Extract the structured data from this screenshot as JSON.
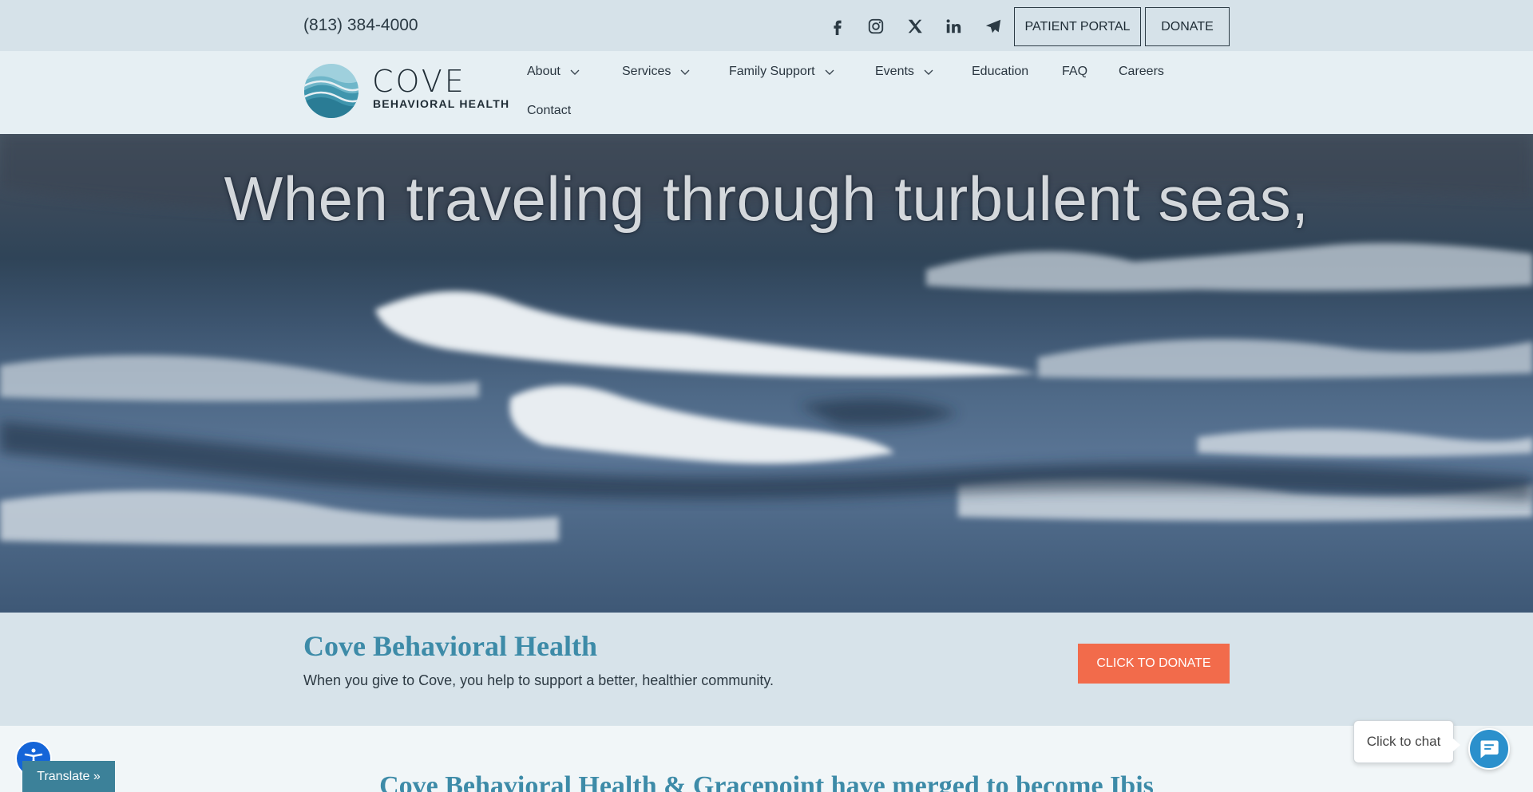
{
  "topbar": {
    "phone": "(813) 384-4000",
    "social_icons": [
      "facebook-icon",
      "instagram-icon",
      "x-twitter-icon",
      "linkedin-icon",
      "telegram-icon"
    ],
    "patient_portal_label": "PATIENT PORTAL",
    "donate_label": "DONATE"
  },
  "brand": {
    "name": "COVE",
    "subtitle": "BEHAVIORAL HEALTH"
  },
  "nav": {
    "items": [
      {
        "label": "About",
        "has_dropdown": true
      },
      {
        "label": "Services",
        "has_dropdown": true
      },
      {
        "label": "Family Support",
        "has_dropdown": true
      },
      {
        "label": "Events",
        "has_dropdown": true
      },
      {
        "label": "Education",
        "has_dropdown": false
      },
      {
        "label": "FAQ",
        "has_dropdown": false
      },
      {
        "label": "Careers",
        "has_dropdown": false
      },
      {
        "label": "Contact",
        "has_dropdown": false
      }
    ]
  },
  "hero": {
    "caption": "When traveling through turbulent seas,"
  },
  "donate_section": {
    "title": "Cove Behavioral Health",
    "description": "When you give to Cove, you help to support a better, healthier community.",
    "cta_label": "CLICK TO DONATE"
  },
  "merger": {
    "headline": "Cove Behavioral Health & Gracepoint have merged to become Ibis"
  },
  "widgets": {
    "chat_prompt": "Click to chat",
    "translate_label": "Translate »"
  },
  "colors": {
    "accent_teal": "#3d8ba8",
    "donate_orange": "#f26b4b",
    "chat_blue": "#2b90cc",
    "accessibility_blue": "#1565d8"
  }
}
